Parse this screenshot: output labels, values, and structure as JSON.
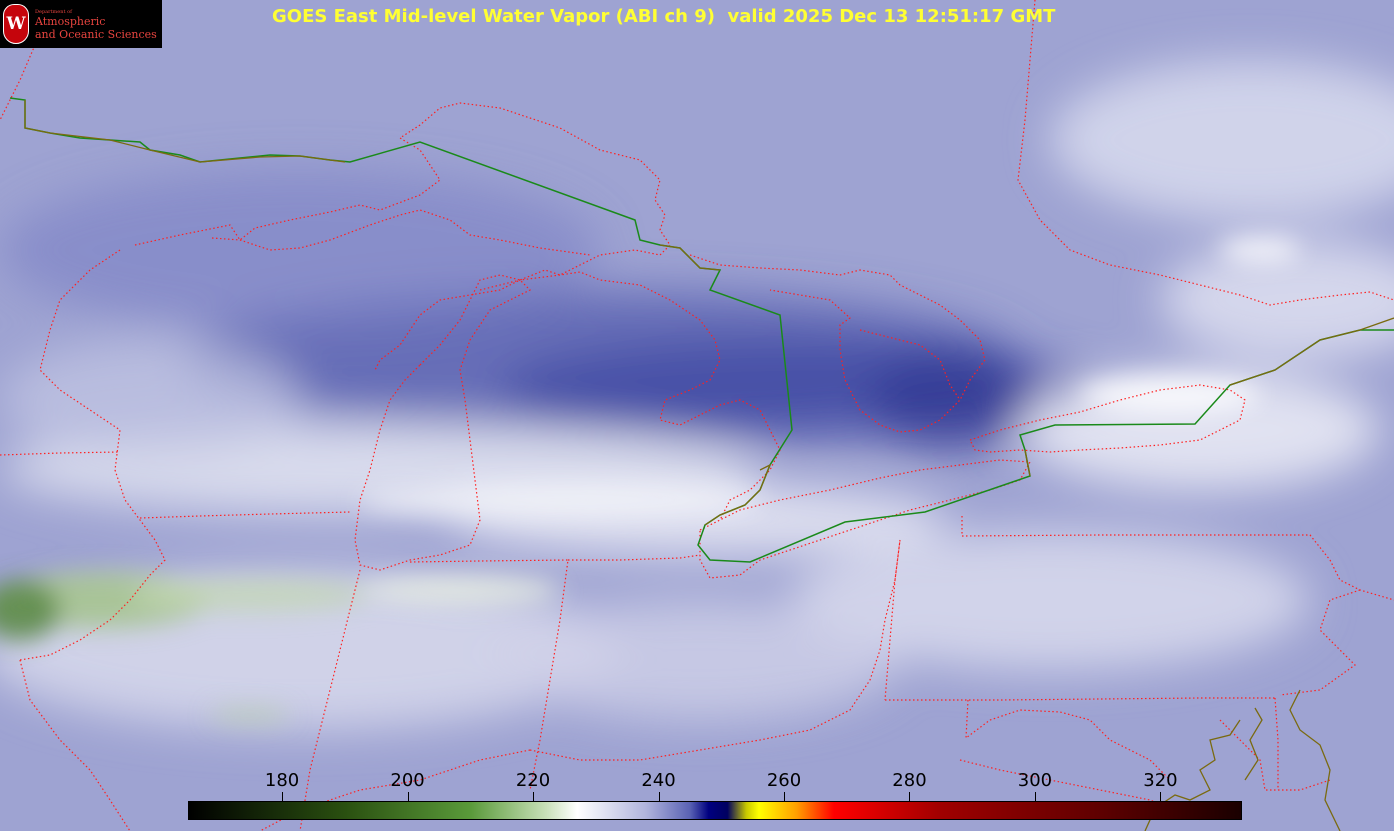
{
  "title": "GOES East Mid-level Water Vapor (ABI ch 9)  valid 2025 Dec 13 12:51:17 GMT",
  "logo": {
    "department": "Department of",
    "line1": "Atmospheric",
    "line2": "and Oceanic Sciences",
    "seal_letter": "W"
  },
  "colorbar": {
    "ticks": [
      "180",
      "200",
      "220",
      "240",
      "260",
      "280",
      "300",
      "320"
    ],
    "tick_values": [
      180,
      200,
      220,
      240,
      260,
      280,
      300,
      320
    ],
    "range": [
      165,
      333
    ],
    "stops": [
      {
        "v": 165,
        "c": "#000000"
      },
      {
        "v": 190,
        "c": "#2a5010"
      },
      {
        "v": 210,
        "c": "#5a9a3a"
      },
      {
        "v": 222,
        "c": "#c8e0b8"
      },
      {
        "v": 227,
        "c": "#ffffff"
      },
      {
        "v": 238,
        "c": "#b0b4dc"
      },
      {
        "v": 245,
        "c": "#5a62b4"
      },
      {
        "v": 248,
        "c": "#000080"
      },
      {
        "v": 251,
        "c": "#000060"
      },
      {
        "v": 254,
        "c": "#c8c800"
      },
      {
        "v": 256,
        "c": "#ffff00"
      },
      {
        "v": 262,
        "c": "#ffa000"
      },
      {
        "v": 268,
        "c": "#ff0000"
      },
      {
        "v": 285,
        "c": "#a00000"
      },
      {
        "v": 310,
        "c": "#600000"
      },
      {
        "v": 333,
        "c": "#1a0000"
      }
    ]
  },
  "colors": {
    "boundary": "#ff2020",
    "border_line": "#1a8a1a",
    "coast": "#6b5a10",
    "title": "#ffff33"
  }
}
